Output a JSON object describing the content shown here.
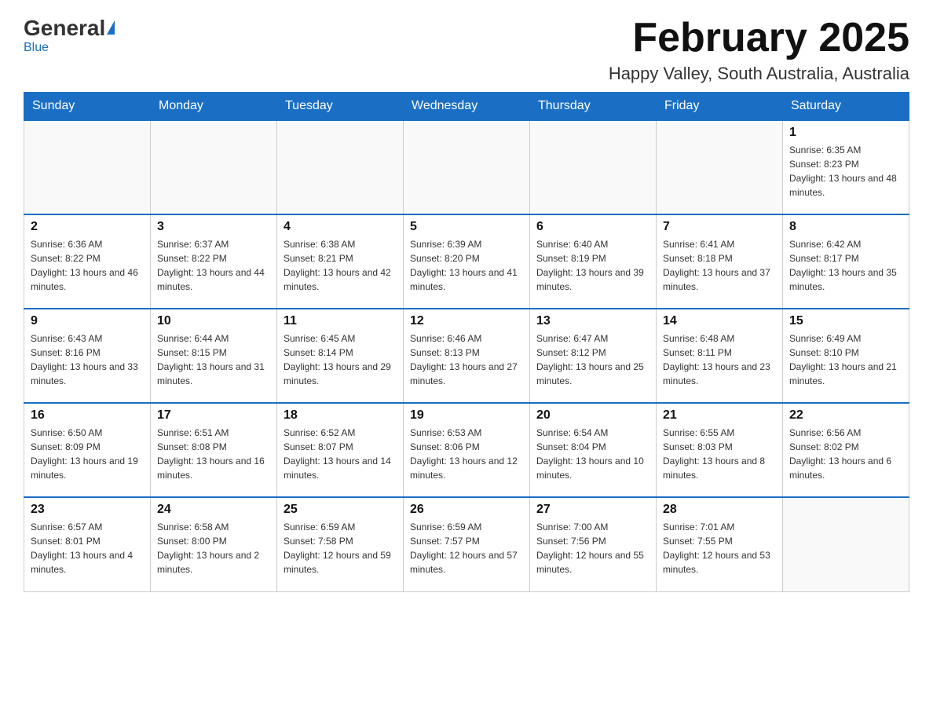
{
  "header": {
    "logo_general": "General",
    "logo_blue": "Blue",
    "month_title": "February 2025",
    "location": "Happy Valley, South Australia, Australia"
  },
  "weekdays": [
    "Sunday",
    "Monday",
    "Tuesday",
    "Wednesday",
    "Thursday",
    "Friday",
    "Saturday"
  ],
  "weeks": [
    [
      {
        "day": "",
        "info": ""
      },
      {
        "day": "",
        "info": ""
      },
      {
        "day": "",
        "info": ""
      },
      {
        "day": "",
        "info": ""
      },
      {
        "day": "",
        "info": ""
      },
      {
        "day": "",
        "info": ""
      },
      {
        "day": "1",
        "info": "Sunrise: 6:35 AM\nSunset: 8:23 PM\nDaylight: 13 hours and 48 minutes."
      }
    ],
    [
      {
        "day": "2",
        "info": "Sunrise: 6:36 AM\nSunset: 8:22 PM\nDaylight: 13 hours and 46 minutes."
      },
      {
        "day": "3",
        "info": "Sunrise: 6:37 AM\nSunset: 8:22 PM\nDaylight: 13 hours and 44 minutes."
      },
      {
        "day": "4",
        "info": "Sunrise: 6:38 AM\nSunset: 8:21 PM\nDaylight: 13 hours and 42 minutes."
      },
      {
        "day": "5",
        "info": "Sunrise: 6:39 AM\nSunset: 8:20 PM\nDaylight: 13 hours and 41 minutes."
      },
      {
        "day": "6",
        "info": "Sunrise: 6:40 AM\nSunset: 8:19 PM\nDaylight: 13 hours and 39 minutes."
      },
      {
        "day": "7",
        "info": "Sunrise: 6:41 AM\nSunset: 8:18 PM\nDaylight: 13 hours and 37 minutes."
      },
      {
        "day": "8",
        "info": "Sunrise: 6:42 AM\nSunset: 8:17 PM\nDaylight: 13 hours and 35 minutes."
      }
    ],
    [
      {
        "day": "9",
        "info": "Sunrise: 6:43 AM\nSunset: 8:16 PM\nDaylight: 13 hours and 33 minutes."
      },
      {
        "day": "10",
        "info": "Sunrise: 6:44 AM\nSunset: 8:15 PM\nDaylight: 13 hours and 31 minutes."
      },
      {
        "day": "11",
        "info": "Sunrise: 6:45 AM\nSunset: 8:14 PM\nDaylight: 13 hours and 29 minutes."
      },
      {
        "day": "12",
        "info": "Sunrise: 6:46 AM\nSunset: 8:13 PM\nDaylight: 13 hours and 27 minutes."
      },
      {
        "day": "13",
        "info": "Sunrise: 6:47 AM\nSunset: 8:12 PM\nDaylight: 13 hours and 25 minutes."
      },
      {
        "day": "14",
        "info": "Sunrise: 6:48 AM\nSunset: 8:11 PM\nDaylight: 13 hours and 23 minutes."
      },
      {
        "day": "15",
        "info": "Sunrise: 6:49 AM\nSunset: 8:10 PM\nDaylight: 13 hours and 21 minutes."
      }
    ],
    [
      {
        "day": "16",
        "info": "Sunrise: 6:50 AM\nSunset: 8:09 PM\nDaylight: 13 hours and 19 minutes."
      },
      {
        "day": "17",
        "info": "Sunrise: 6:51 AM\nSunset: 8:08 PM\nDaylight: 13 hours and 16 minutes."
      },
      {
        "day": "18",
        "info": "Sunrise: 6:52 AM\nSunset: 8:07 PM\nDaylight: 13 hours and 14 minutes."
      },
      {
        "day": "19",
        "info": "Sunrise: 6:53 AM\nSunset: 8:06 PM\nDaylight: 13 hours and 12 minutes."
      },
      {
        "day": "20",
        "info": "Sunrise: 6:54 AM\nSunset: 8:04 PM\nDaylight: 13 hours and 10 minutes."
      },
      {
        "day": "21",
        "info": "Sunrise: 6:55 AM\nSunset: 8:03 PM\nDaylight: 13 hours and 8 minutes."
      },
      {
        "day": "22",
        "info": "Sunrise: 6:56 AM\nSunset: 8:02 PM\nDaylight: 13 hours and 6 minutes."
      }
    ],
    [
      {
        "day": "23",
        "info": "Sunrise: 6:57 AM\nSunset: 8:01 PM\nDaylight: 13 hours and 4 minutes."
      },
      {
        "day": "24",
        "info": "Sunrise: 6:58 AM\nSunset: 8:00 PM\nDaylight: 13 hours and 2 minutes."
      },
      {
        "day": "25",
        "info": "Sunrise: 6:59 AM\nSunset: 7:58 PM\nDaylight: 12 hours and 59 minutes."
      },
      {
        "day": "26",
        "info": "Sunrise: 6:59 AM\nSunset: 7:57 PM\nDaylight: 12 hours and 57 minutes."
      },
      {
        "day": "27",
        "info": "Sunrise: 7:00 AM\nSunset: 7:56 PM\nDaylight: 12 hours and 55 minutes."
      },
      {
        "day": "28",
        "info": "Sunrise: 7:01 AM\nSunset: 7:55 PM\nDaylight: 12 hours and 53 minutes."
      },
      {
        "day": "",
        "info": ""
      }
    ]
  ]
}
